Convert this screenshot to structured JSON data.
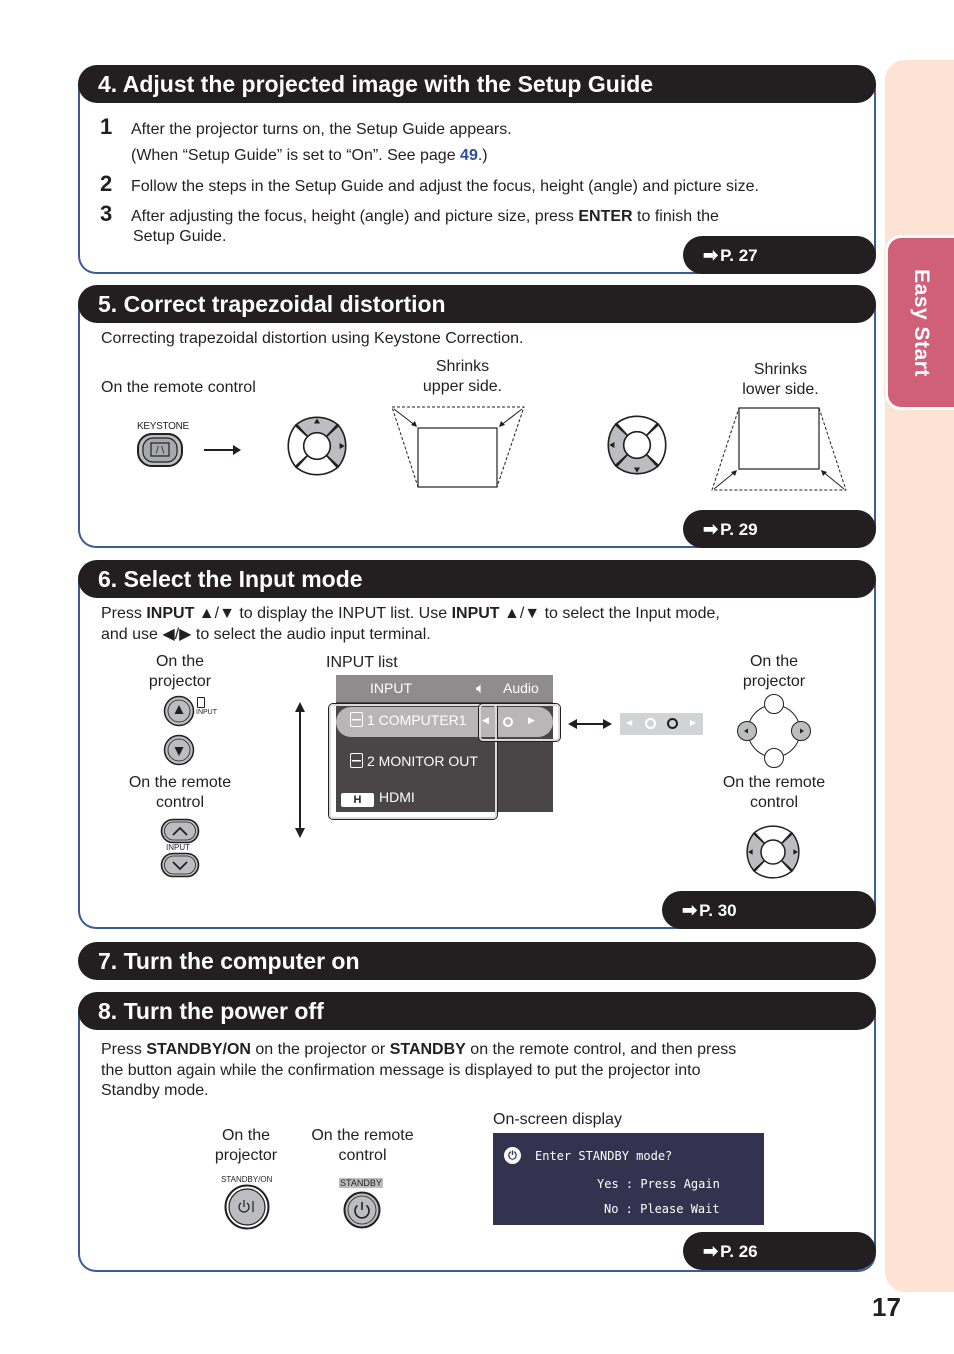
{
  "side_tab": {
    "label": "Easy Start",
    "color": "#d05f78"
  },
  "page_number": "17",
  "sections": {
    "s4": {
      "title": "4.  Adjust the projected image with the Setup Guide",
      "steps": [
        {
          "num": "1",
          "text": "After the projector turns on, the Setup Guide appears.",
          "text2_pre": "(When “Setup Guide” is set to “On”. See page ",
          "text2_link": "49",
          "text2_post": ".)"
        },
        {
          "num": "2",
          "text": "Follow the steps in the Setup Guide and adjust the focus, height (angle) and picture size."
        },
        {
          "num": "3",
          "text_pre": "After adjusting the focus, height (angle) and picture size, press ",
          "text_bold": "ENTER",
          "text_post": " to finish the",
          "text_line2": "Setup Guide."
        }
      ],
      "ref": "P. 27"
    },
    "s5": {
      "title": "5. Correct trapezoidal distortion",
      "intro": "Correcting trapezoidal distortion using Keystone Correction.",
      "remote_label": "On the remote control",
      "keystone_label": "KEYSTONE",
      "keystone_glyph": "/ \\",
      "upper_label_1": "Shrinks",
      "upper_label_2": "upper side.",
      "lower_label_1": "Shrinks",
      "lower_label_2": "lower side.",
      "ref": "P. 29"
    },
    "s6": {
      "title": "6. Select the Input mode",
      "line1_a": "Press ",
      "line1_b": "INPUT",
      "line1_c": " ▲/▼ to display the INPUT list. Use ",
      "line1_d": "INPUT",
      "line1_e": " ▲/▼ to select the Input mode,",
      "line2": "and use ◀/▶ to select the audio input terminal.",
      "left_projector_1": "On the",
      "left_projector_2": "projector",
      "input_small": "INPUT",
      "left_remote_1": "On the remote",
      "left_remote_2": "control",
      "remote_input_small": "INPUT",
      "input_list_label": "INPUT list",
      "osd": {
        "header_input": "INPUT",
        "header_audio": "Audio",
        "items": [
          {
            "icon": "computer-icon",
            "label": "1 COMPUTER1",
            "selected": true
          },
          {
            "icon": "computer-icon",
            "label": "2 MONITOR OUT",
            "selected": false
          },
          {
            "icon": "hdmi-badge",
            "badge": "H",
            "label": "HDMI",
            "selected": false
          }
        ]
      },
      "right_projector_1": "On the",
      "right_projector_2": "projector",
      "right_remote_1": "On the remote",
      "right_remote_2": "control",
      "ref": "P. 30"
    },
    "s7": {
      "title": "7. Turn the computer on"
    },
    "s8": {
      "title": "8. Turn the power off",
      "line1_a": "Press ",
      "line1_b": "STANDBY/ON",
      "line1_c": " on the projector or ",
      "line1_d": "STANDBY",
      "line1_e": " on the remote control, and then press",
      "line2": "the button again while the confirmation message is displayed to put the projector into",
      "line3": "Standby mode.",
      "projector_1": "On the",
      "projector_2": "projector",
      "projector_btn_label": "STANDBY/ON",
      "remote_1": "On the remote",
      "remote_2": "control",
      "remote_btn_label": "STANDBY",
      "osd_label": "On-screen display",
      "osd_line1": "Enter STANDBY mode?",
      "osd_line2": "Yes : Press Again",
      "osd_line3": "No : Please Wait",
      "ref": "P. 26"
    }
  }
}
